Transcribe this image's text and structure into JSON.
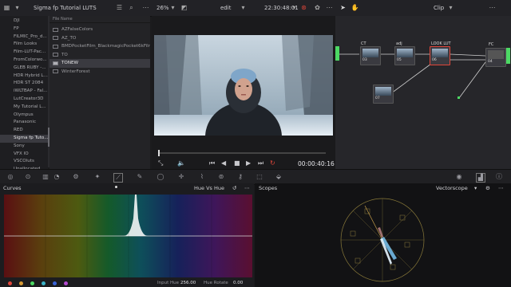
{
  "topbar": {
    "project_title": "Sigma fp Tutorial LUTS",
    "zoom": "26%",
    "timeline_name": "edit",
    "timecode": "22:30:48:01",
    "mode_label": "Clip"
  },
  "sidebar": {
    "items": [
      "DJI",
      "FP",
      "FILMIC_Pro_d...",
      "Film Looks",
      "Film-LUT-Pac...",
      "FromColorwo...",
      "GLEB RUBY -...",
      "HDR Hybrid L...",
      "HDR ST 2084",
      "iWLTBAP - Fal...",
      "LutCreator3D",
      "My Tutorial L...",
      "Olympus",
      "Panasonic",
      "RED",
      "Sigma fp Tuto...",
      "Sony",
      "VFX IO",
      "VSCOluts",
      "Unallocated"
    ],
    "selected_index": 15
  },
  "filelist": {
    "header": "File Name",
    "items": [
      "AZFalseColors",
      "AZ_TO",
      "BMDPocketFilm_BlackmagicPocket6kFilm-Log",
      "TO",
      "TONEW",
      "WinterForest"
    ],
    "selected_index": 4
  },
  "viewer": {
    "playback_timecode": "00:00:40:16"
  },
  "nodes": {
    "labels": [
      "CT",
      "adj",
      "LOOK LUT",
      "FC"
    ],
    "numbers": [
      "03",
      "05",
      "06",
      "04",
      "07"
    ]
  },
  "curves": {
    "title": "Curves",
    "mode": "Hue Vs Hue",
    "input_hue_label": "Input Hue",
    "input_hue_value": "256.00",
    "hue_rotate_label": "Hue Rotate",
    "hue_rotate_value": "0.00"
  },
  "scopes": {
    "title": "Scopes",
    "type": "Vectorscope"
  },
  "colors": {
    "accent_red": "#e0463a",
    "accent_orange": "#d79a35",
    "node_green": "#4cd964"
  }
}
